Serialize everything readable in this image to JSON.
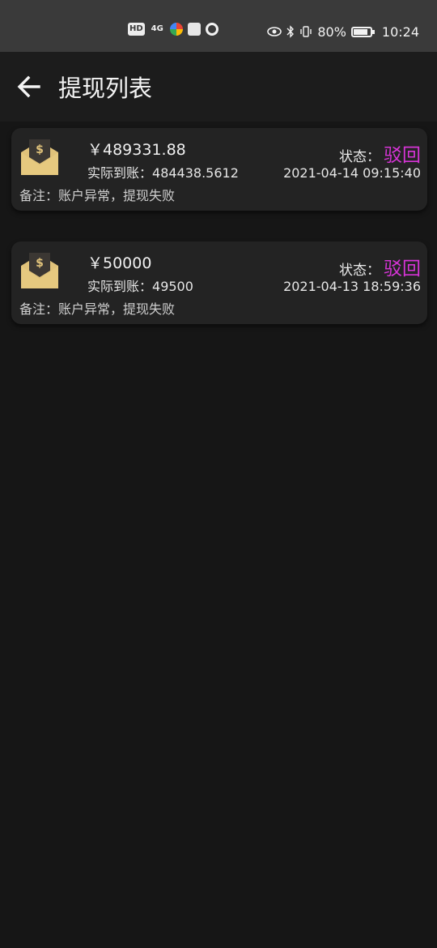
{
  "status_bar": {
    "hd": "HD",
    "network": "4G",
    "battery_pct": "80%",
    "time": "10:24"
  },
  "header": {
    "title": "提现列表"
  },
  "records": [
    {
      "amount": "￥489331.88",
      "actual_label": "实际到账：",
      "actual_value": "484438.5612",
      "status_label": "状态：",
      "status_value": "驳回",
      "datetime": "2021-04-14 09:15:40",
      "remark_label": "备注：",
      "remark_value": "账户异常，提现失败"
    },
    {
      "amount": "￥50000",
      "actual_label": "实际到账：",
      "actual_value": "49500",
      "status_label": "状态：",
      "status_value": "驳回",
      "datetime": "2021-04-13 18:59:36",
      "remark_label": "备注：",
      "remark_value": "账户异常，提现失败"
    }
  ],
  "colors": {
    "status_rejected": "#d634d6",
    "envelope": "#e0c27a"
  }
}
